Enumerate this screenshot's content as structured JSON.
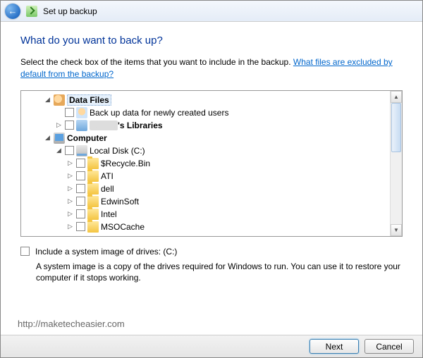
{
  "window": {
    "title": "Set up backup"
  },
  "heading": "What do you want to back up?",
  "description": "Select the check box of the items that you want to include in the backup. ",
  "help_link": "What files are excluded by default from the backup?",
  "tree": {
    "data_files": "Data Files",
    "new_users": "Back up data for newly created users",
    "user_lib_prefix": "",
    "user_lib_suffix": "'s Libraries",
    "computer": "Computer",
    "local_disk": "Local Disk (C:)",
    "folders": [
      "$Recycle.Bin",
      "ATI",
      "dell",
      "EdwinSoft",
      "Intel",
      "MSOCache"
    ]
  },
  "system_image": {
    "label": "Include a system image of drives: (C:)",
    "desc": "A system image is a copy of the drives required for Windows to run. You can use it to restore your computer if it stops working."
  },
  "watermark": "http://maketecheasier.com",
  "buttons": {
    "next": "Next",
    "cancel": "Cancel"
  }
}
